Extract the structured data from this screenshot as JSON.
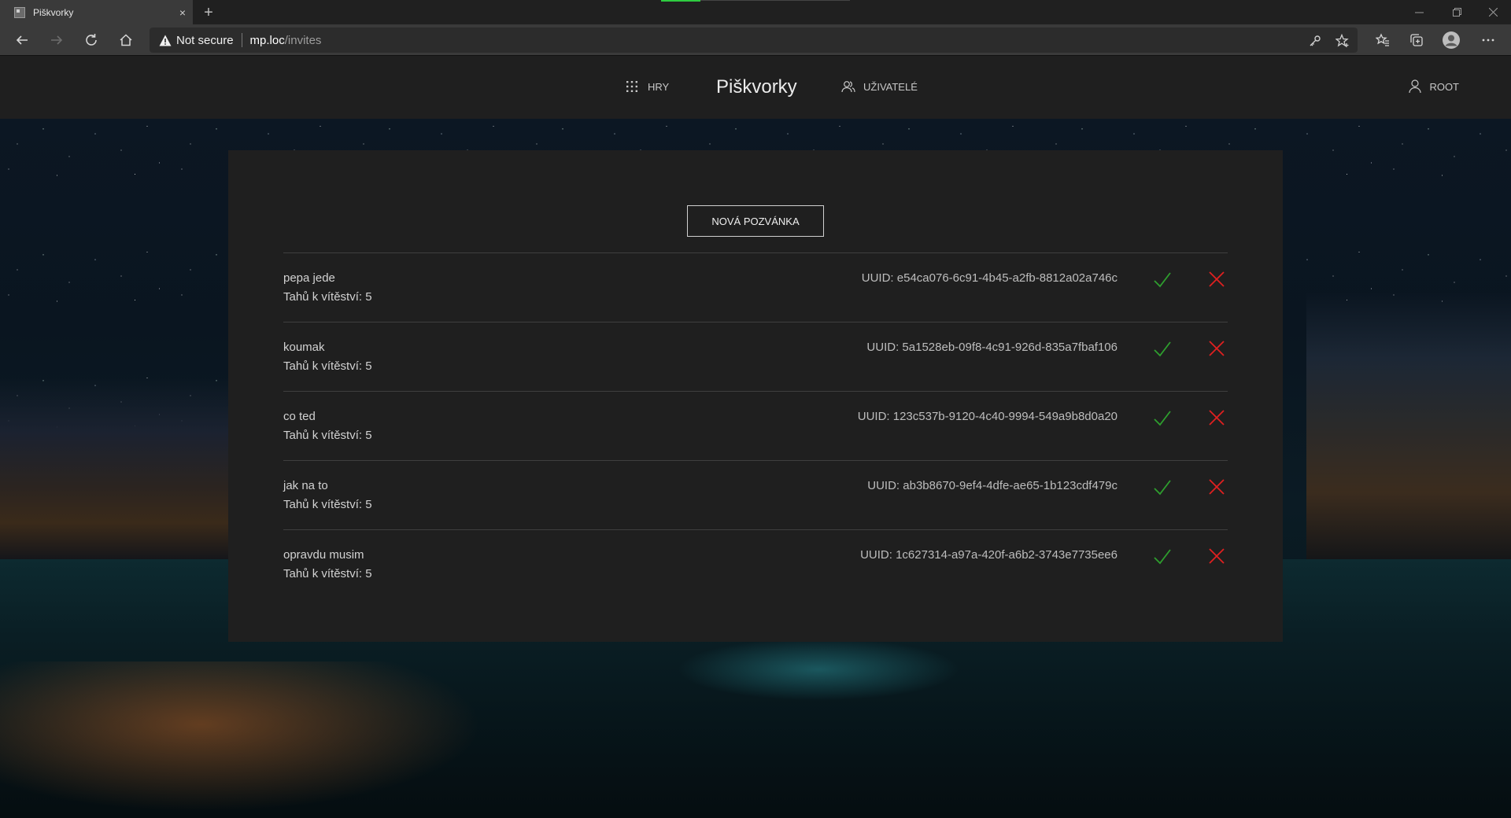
{
  "browser": {
    "tab_title": "Piškvorky",
    "tab_close": "×",
    "new_tab": "+",
    "security_label": "Not secure",
    "url_host": "mp.loc",
    "url_path": "/invites"
  },
  "header": {
    "nav_games": "HRY",
    "title": "Piškvorky",
    "nav_users": "UŽIVATELÉ",
    "user": "ROOT"
  },
  "main": {
    "new_invite_button": "NOVÁ POZVÁNKA",
    "invites": [
      {
        "name": "pepa jede",
        "moves_to_win": "Tahů k vítěství: 5",
        "uuid": "UUID: e54ca076-6c91-4b45-a2fb-8812a02a746c"
      },
      {
        "name": "koumak",
        "moves_to_win": "Tahů k vítěství: 5",
        "uuid": "UUID: 5a1528eb-09f8-4c91-926d-835a7fbaf106"
      },
      {
        "name": "co ted",
        "moves_to_win": "Tahů k vítěství: 5",
        "uuid": "UUID: 123c537b-9120-4c40-9994-549a9b8d0a20"
      },
      {
        "name": "jak na to",
        "moves_to_win": "Tahů k vítěství: 5",
        "uuid": "UUID: ab3b8670-9ef4-4dfe-ae65-1b123cdf479c"
      },
      {
        "name": "opravdu musim",
        "moves_to_win": "Tahů k vítěství: 5",
        "uuid": "UUID: 1c627314-a97a-420f-a6b2-3743e7735ee6"
      }
    ]
  },
  "colors": {
    "accept": "#2e9e2e",
    "decline": "#e02020",
    "panel": "#1f1f1f"
  },
  "icons": {
    "accept": "check-icon",
    "decline": "close-x-icon",
    "games": "grid-icon",
    "users": "users-icon",
    "user": "person-icon"
  }
}
